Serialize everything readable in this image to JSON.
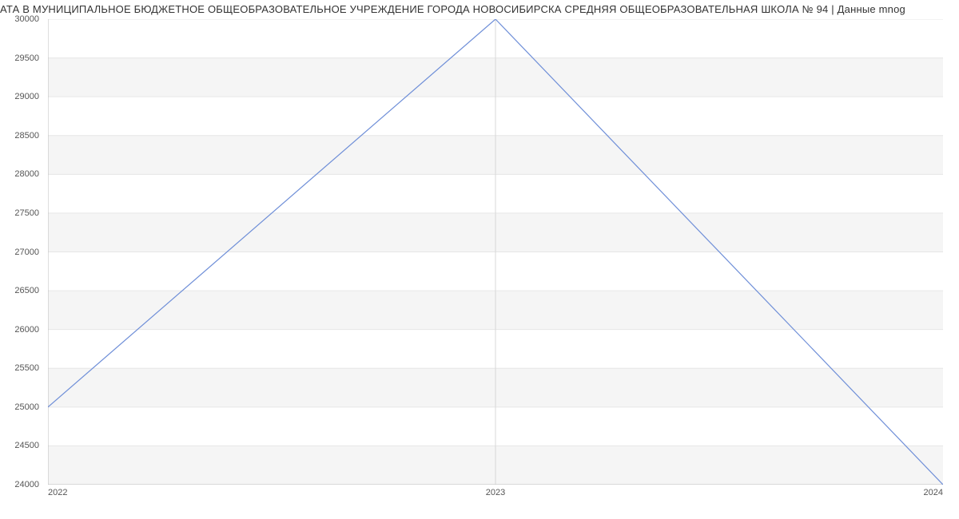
{
  "chart_data": {
    "type": "line",
    "title": "АТА В МУНИЦИПАЛЬНОЕ БЮДЖЕТНОЕ ОБЩЕОБРАЗОВАТЕЛЬНОЕ УЧРЕЖДЕНИЕ ГОРОДА НОВОСИБИРСКА СРЕДНЯЯ ОБЩЕОБРАЗОВАТЕЛЬНАЯ ШКОЛА № 94 | Данные mnog",
    "xlabel": "",
    "ylabel": "",
    "x": [
      2022,
      2023,
      2024
    ],
    "values": [
      25000,
      30000,
      24000
    ],
    "y_ticks": [
      24000,
      24500,
      25000,
      25500,
      26000,
      26500,
      27000,
      27500,
      28000,
      28500,
      29000,
      29500,
      30000
    ],
    "x_ticks": [
      2022,
      2023,
      2024
    ],
    "ylim": [
      24000,
      30000
    ],
    "xlim": [
      2022,
      2024
    ]
  },
  "geom": {
    "pw": 1120,
    "ph": 583
  }
}
